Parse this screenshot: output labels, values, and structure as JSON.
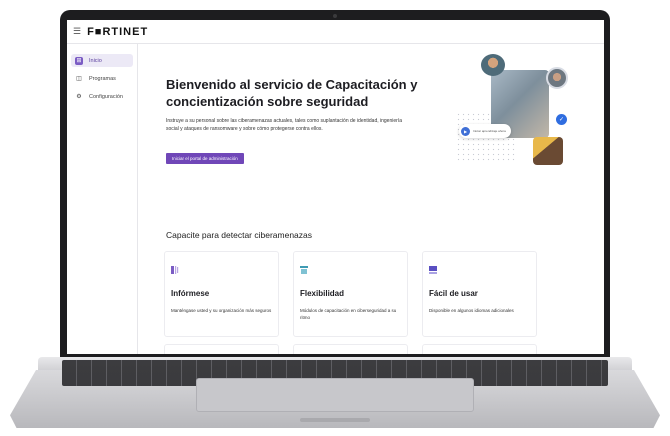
{
  "app": {
    "logo_text": "F■RTINET",
    "menu_icon": "hamburger-icon"
  },
  "sidebar": {
    "items": [
      {
        "label": "Inicio",
        "icon": "home-icon",
        "active": true
      },
      {
        "label": "Programas",
        "icon": "document-icon",
        "active": false
      },
      {
        "label": "Configuración",
        "icon": "gear-icon",
        "active": false
      }
    ]
  },
  "hero": {
    "title": "Bienvenido al servicio de Capacitación y concientización sobre seguridad",
    "intro": "Instruye a su personal sobre las ciberamenazas actuales, tales como suplantación de identidad, ingeniería social y ataques de ransomware y sobre cómo protegerse contra ellos.",
    "cta_label": "Iniciar el portal de administración",
    "chip_text": "Iniciar aprendizaje ahora",
    "accent_color": "#7047b8"
  },
  "features": {
    "section_title": "Capacite para detectar ciberamenazas",
    "cards": [
      {
        "title": "Infórmese",
        "desc": "Manténgase usted y su organización más seguros",
        "icon": "book-icon",
        "color": "#7b5cc4"
      },
      {
        "title": "Flexibilidad",
        "desc": "Módulos de capacitación en ciberseguridad a su ritmo",
        "icon": "layers-icon",
        "color": "#3f9bb3"
      },
      {
        "title": "Fácil de usar",
        "desc": "Disponible en algunos idiomas adicionales",
        "icon": "window-icon",
        "color": "#5a4fc2"
      },
      {
        "title": "",
        "desc": "",
        "icon": "columns-icon",
        "color": "#7b5cc4"
      },
      {
        "title": "",
        "desc": "",
        "icon": "bars-icon",
        "color": "#7b5cc4"
      },
      {
        "title": "",
        "desc": "",
        "icon": "list-icon",
        "color": "#5a4fc2"
      }
    ]
  }
}
